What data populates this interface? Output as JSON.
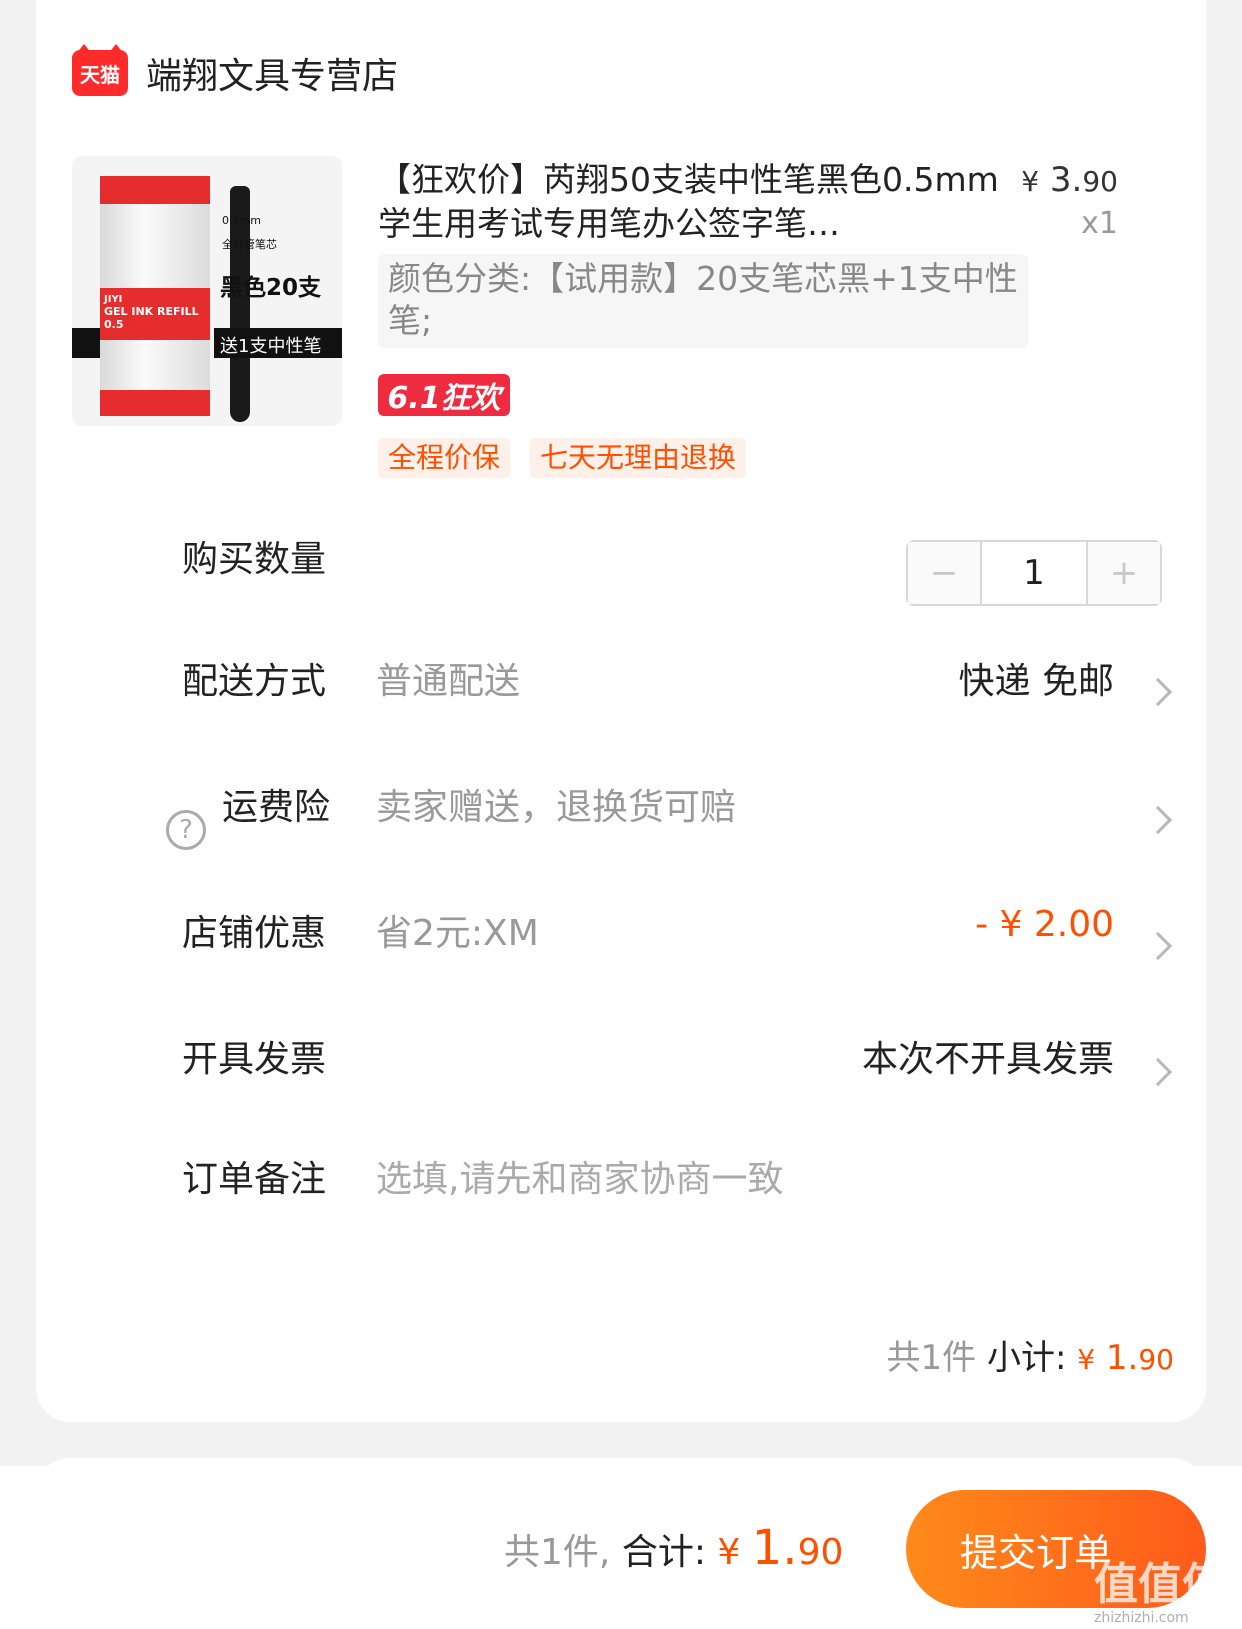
{
  "shop": {
    "logo_text": "天猫",
    "name": "端翔文具专营店"
  },
  "product": {
    "thumb": {
      "brand": "JIYI",
      "refill_text": "GEL INK REFILL 0.5",
      "size_text": "0.5mm",
      "type_text": "全针管笔芯",
      "count_text": "黑色20支",
      "band_text": "送1支中性笔"
    },
    "title": "【狂欢价】芮翔50支装中性笔黑色0.5mm学生用考试专用笔办公签字笔…",
    "price_yen": "¥",
    "price_int": "3.",
    "price_dec": "90",
    "quantity_x": "x1",
    "spec": "颜色分类:【试用款】20支笔芯黑+1支中性笔;",
    "promo_badge": "6.1狂欢",
    "tags": [
      "全程价保",
      "七天无理由退换"
    ]
  },
  "rows": {
    "quantity": {
      "label": "购买数量",
      "minus": "−",
      "value": "1",
      "plus": "+"
    },
    "delivery": {
      "label": "配送方式",
      "value": "普通配送",
      "right": "快递 免邮"
    },
    "insurance": {
      "icon": "?",
      "label": "运费险",
      "value": "卖家赠送，退换货可赔"
    },
    "discount": {
      "label": "店铺优惠",
      "value": "省2元:XM",
      "right": "- ¥ 2.00"
    },
    "invoice": {
      "label": "开具发票",
      "right": "本次不开具发票"
    },
    "note": {
      "label": "订单备注",
      "placeholder": "选填,请先和商家协商一致"
    }
  },
  "subtotal": {
    "count": "共1件",
    "label": "小计:",
    "yen": "¥",
    "int": "1.",
    "dec": "90"
  },
  "footer": {
    "count": "共1件,",
    "label": "合计:",
    "yen": "¥",
    "int": "1.",
    "dec": "90",
    "submit": "提交订单"
  },
  "watermark": {
    "main": "值值值",
    "sub": "zhizhizhi.com"
  }
}
